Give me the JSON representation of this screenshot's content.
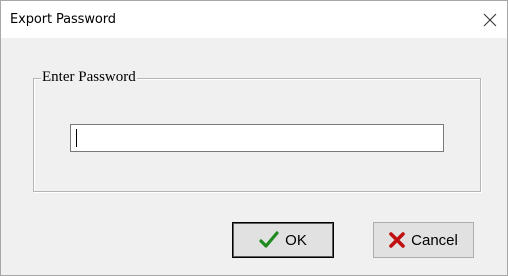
{
  "window": {
    "title": "Export Password",
    "close_icon": "close-icon"
  },
  "group": {
    "label": "Enter Password"
  },
  "password": {
    "value": ""
  },
  "buttons": {
    "ok_label": "OK",
    "ok_icon": "checkmark-icon",
    "ok_icon_color": "#1f8a1f",
    "cancel_label": "Cancel",
    "cancel_icon": "x-icon",
    "cancel_icon_color": "#c01010"
  }
}
